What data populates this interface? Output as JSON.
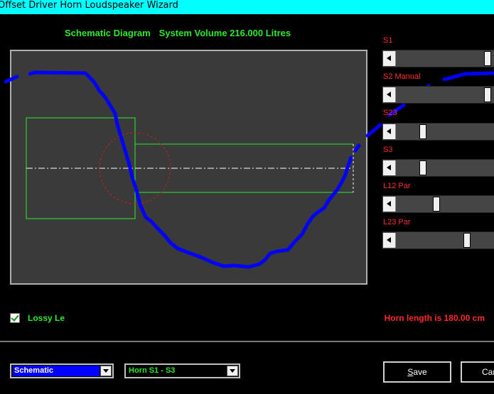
{
  "window": {
    "title": "Offset Driver Horn Loudspeaker Wizard"
  },
  "diagram": {
    "heading_label": "Schematic Diagram",
    "heading_volume": "System Volume 216.000 Litres"
  },
  "sliders": [
    {
      "label": "S1",
      "value": 1.0
    },
    {
      "label": "S2  Manual",
      "value": 1.0
    },
    {
      "label": "S23",
      "value": 0.25
    },
    {
      "label": "S3",
      "value": 0.25
    },
    {
      "label": "L12  Par",
      "value": 0.41
    },
    {
      "label": "L23  Par",
      "value": 0.76
    }
  ],
  "options": {
    "lossy_label": "Lossy Le",
    "lossy_checked": true
  },
  "status": {
    "horn_length": "Horn length is 180.00 cm"
  },
  "controls": {
    "view_select": "Schematic",
    "horn_select": "Horn S1 - S3",
    "save_first": "S",
    "save_rest": "ave",
    "cancel_label": "Car"
  },
  "colors": {
    "title_bar": "#00ffff",
    "heading": "#2ee82e",
    "slider_label": "#ff3030",
    "horn_length": "#ff2a2a",
    "view_select_bg": "#0000ff",
    "horn_select_text": "#2ee82e",
    "annotation_stroke": "#0000ff"
  }
}
